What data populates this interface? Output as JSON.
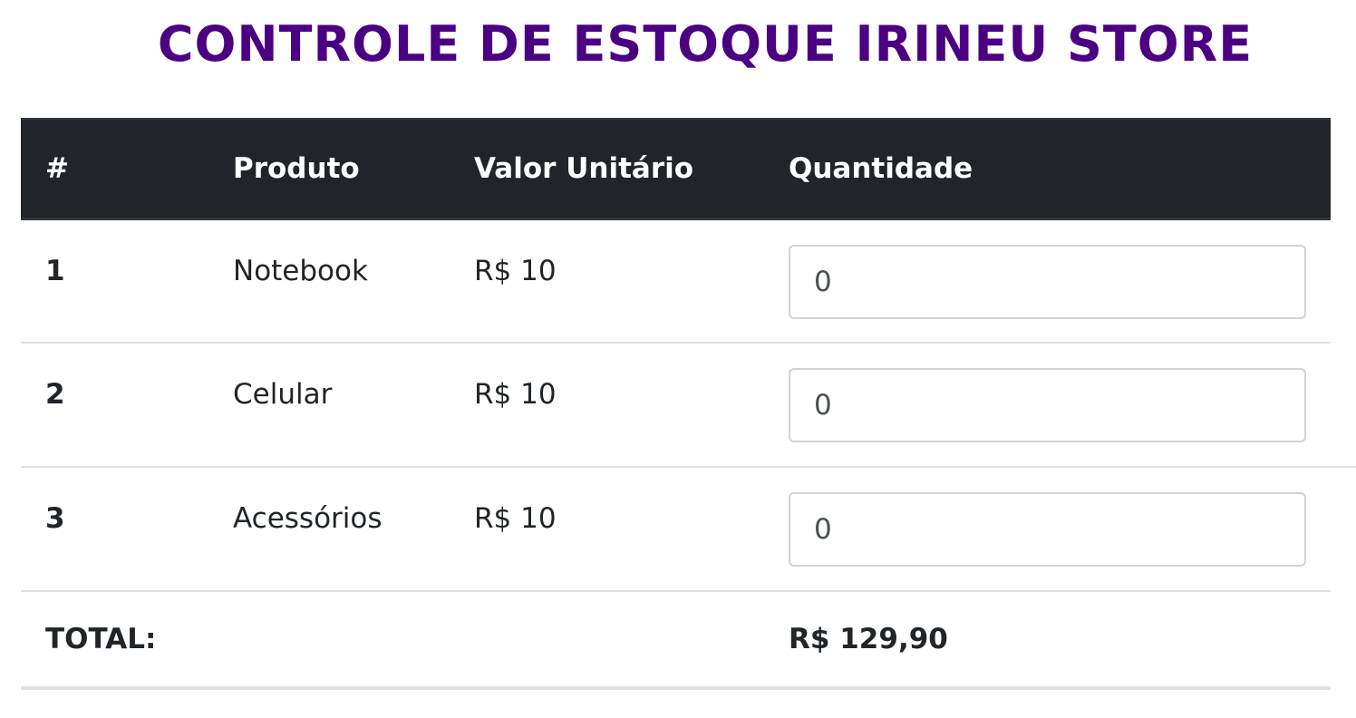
{
  "page": {
    "title": "CONTROLE DE ESTOQUE IRINEU STORE"
  },
  "table": {
    "headers": [
      "#",
      "Produto",
      "Valor Unitário",
      "Quantidade"
    ],
    "rows": [
      {
        "id": "1",
        "product": "Notebook",
        "unit_price": "R$ 10",
        "quantity": "0"
      },
      {
        "id": "2",
        "product": "Celular",
        "unit_price": "R$ 10",
        "quantity": "0"
      },
      {
        "id": "3",
        "product": "Acessórios",
        "unit_price": "R$ 10",
        "quantity": "0"
      }
    ],
    "total_label": "TOTAL:",
    "total_value": "R$ 129,90"
  },
  "colors": {
    "title": "#4b0082",
    "header_bg": "#212529",
    "header_text": "#ffffff",
    "divider": "#dee2e6"
  }
}
